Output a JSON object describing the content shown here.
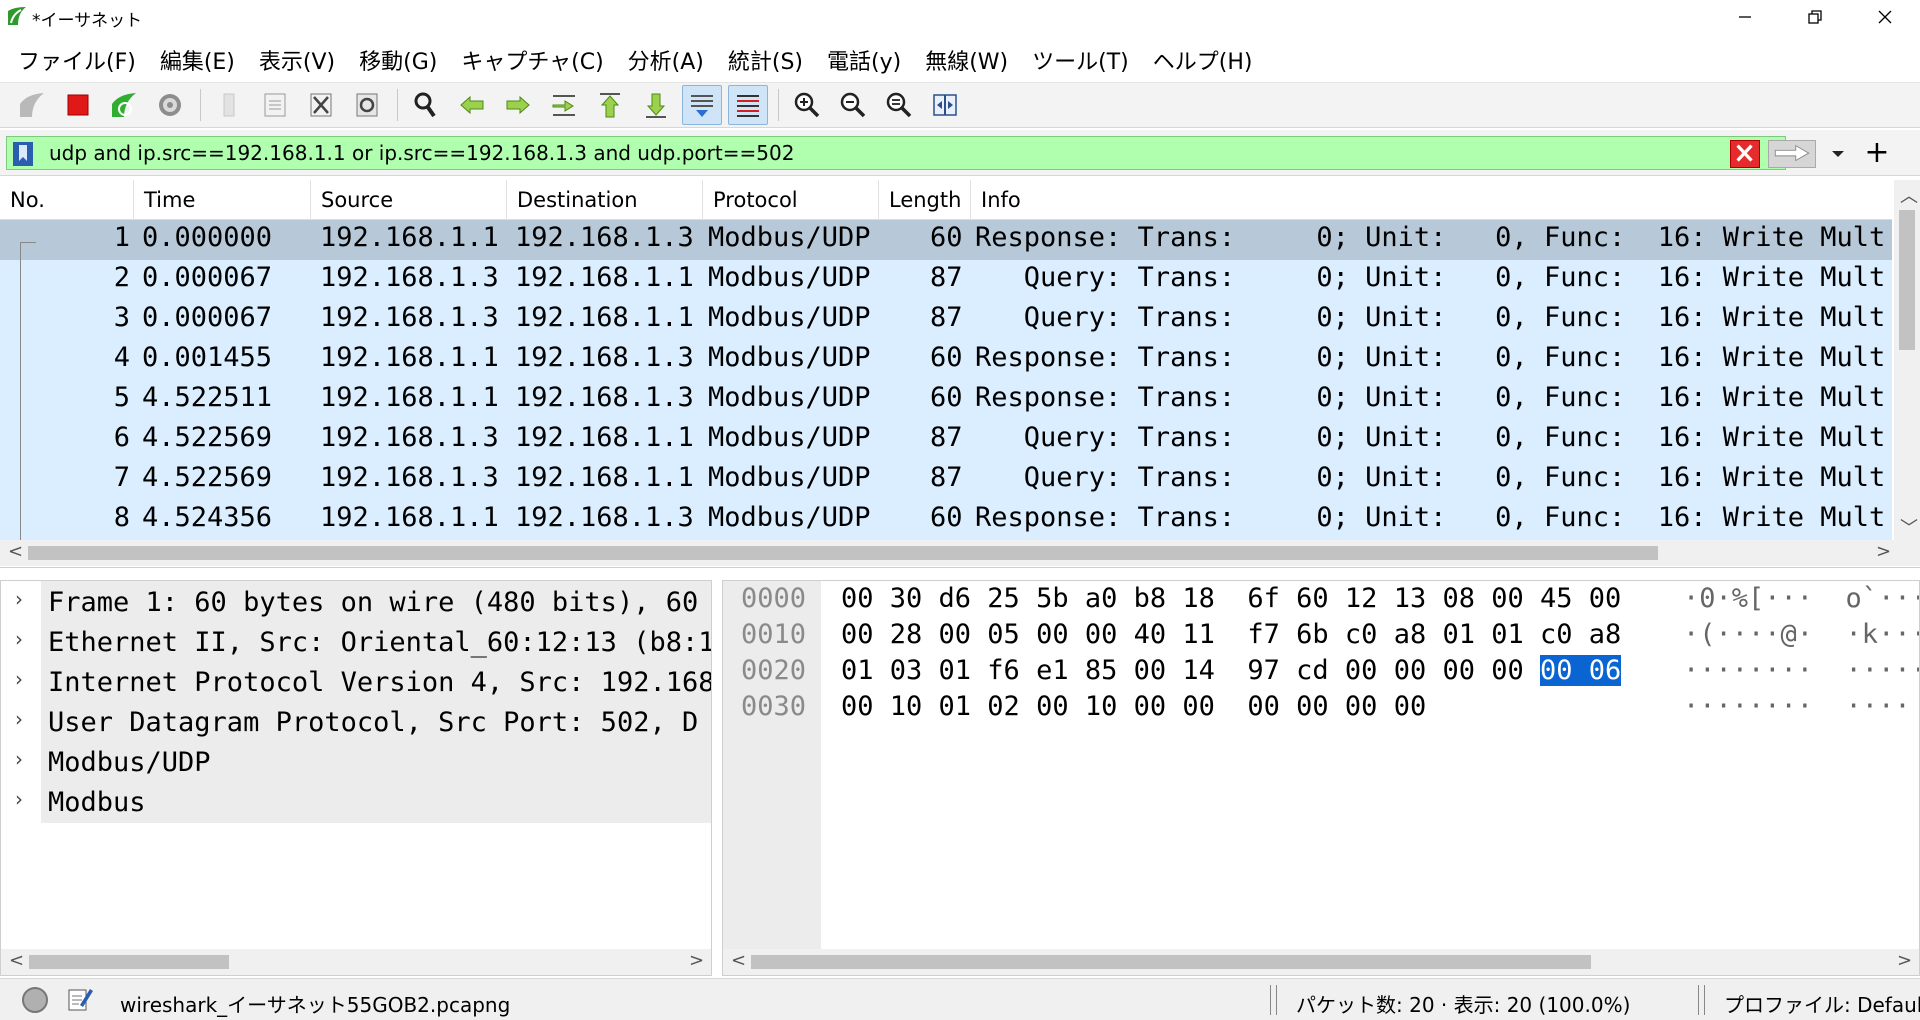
{
  "window": {
    "title": "*イーサネット"
  },
  "menu": [
    "ファイル(F)",
    "編集(E)",
    "表示(V)",
    "移動(G)",
    "キャプチャ(C)",
    "分析(A)",
    "統計(S)",
    "電話(y)",
    "無線(W)",
    "ツール(T)",
    "ヘルプ(H)"
  ],
  "toolbar": {
    "icons": [
      "shark-fin-start-icon",
      "stop-capture-icon",
      "restart-capture-icon",
      "capture-options-icon",
      "open-file-icon",
      "save-file-icon",
      "close-file-icon",
      "reload-file-icon",
      "find-packet-icon",
      "go-back-icon",
      "go-forward-icon",
      "go-to-packet-icon",
      "go-first-icon",
      "go-last-icon",
      "autoscroll-icon",
      "colorize-icon",
      "zoom-in-icon",
      "zoom-out-icon",
      "zoom-normal-icon",
      "resize-columns-icon"
    ]
  },
  "filter": {
    "value": "udp and ip.src==192.168.1.1 or ip.src==192.168.1.3 and udp.port==502"
  },
  "packet_list": {
    "columns": [
      "No.",
      "Time",
      "Source",
      "Destination",
      "Protocol",
      "Length",
      "Info"
    ],
    "rows": [
      {
        "no": "1",
        "time": "0.000000",
        "src": "192.168.1.1",
        "dst": "192.168.1.3",
        "proto": "Modbus/UDP",
        "len": "60",
        "info": "Response: Trans:     0; Unit:   0, Func:  16: Write Mult"
      },
      {
        "no": "2",
        "time": "0.000067",
        "src": "192.168.1.3",
        "dst": "192.168.1.1",
        "proto": "Modbus/UDP",
        "len": "87",
        "info": "   Query: Trans:     0; Unit:   0, Func:  16: Write Mult"
      },
      {
        "no": "3",
        "time": "0.000067",
        "src": "192.168.1.3",
        "dst": "192.168.1.1",
        "proto": "Modbus/UDP",
        "len": "87",
        "info": "   Query: Trans:     0; Unit:   0, Func:  16: Write Mult"
      },
      {
        "no": "4",
        "time": "0.001455",
        "src": "192.168.1.1",
        "dst": "192.168.1.3",
        "proto": "Modbus/UDP",
        "len": "60",
        "info": "Response: Trans:     0; Unit:   0, Func:  16: Write Mult"
      },
      {
        "no": "5",
        "time": "4.522511",
        "src": "192.168.1.1",
        "dst": "192.168.1.3",
        "proto": "Modbus/UDP",
        "len": "60",
        "info": "Response: Trans:     0; Unit:   0, Func:  16: Write Mult"
      },
      {
        "no": "6",
        "time": "4.522569",
        "src": "192.168.1.3",
        "dst": "192.168.1.1",
        "proto": "Modbus/UDP",
        "len": "87",
        "info": "   Query: Trans:     0; Unit:   0, Func:  16: Write Mult"
      },
      {
        "no": "7",
        "time": "4.522569",
        "src": "192.168.1.3",
        "dst": "192.168.1.1",
        "proto": "Modbus/UDP",
        "len": "87",
        "info": "   Query: Trans:     0; Unit:   0, Func:  16: Write Mult"
      },
      {
        "no": "8",
        "time": "4.524356",
        "src": "192.168.1.1",
        "dst": "192.168.1.3",
        "proto": "Modbus/UDP",
        "len": "60",
        "info": "Response: Trans:     0; Unit:   0, Func:  16: Write Mult"
      }
    ]
  },
  "details": [
    "Frame 1: 60 bytes on wire (480 bits), 60",
    "Ethernet II, Src: Oriental_60:12:13 (b8:1",
    "Internet Protocol Version 4, Src: 192.168",
    "User Datagram Protocol, Src Port: 502, D",
    "Modbus/UDP",
    "Modbus"
  ],
  "bytes": [
    {
      "off": "0000",
      "hex_a": "00 30 d6 25 5b a0 b8 18",
      "hex_b": "6f 60 12 13 08 00 45 00",
      "hl": "",
      "ascii": "·0·%[···  o`·····"
    },
    {
      "off": "0010",
      "hex_a": "00 28 00 05 00 00 40 11",
      "hex_b": "f7 6b c0 a8 01 01 c0 a8",
      "hl": "",
      "ascii": "·(····@·  ·k·····"
    },
    {
      "off": "0020",
      "hex_a": "01 03 01 f6 e1 85 00 14",
      "hex_b": "97 cd 00 00 00 00 ",
      "hl": "00 06",
      "ascii": "········  ········"
    },
    {
      "off": "0030",
      "hex_a": "00 10 01 02 00 10 00 00",
      "hex_b": "00 00 00 00",
      "hl": "",
      "ascii": "········  ····"
    }
  ],
  "status": {
    "file": "wireshark_イーサネット55GOB2.pcapng",
    "packets": "パケット数: 20 · 表示: 20 (100.0%)",
    "profile": "プロファイル: Default"
  },
  "colors": {
    "row_bg": "#daeeff",
    "selected_row": "#b7c9d9",
    "filter_valid": "#afffaf",
    "byte_highlight": "#0a64d1"
  }
}
